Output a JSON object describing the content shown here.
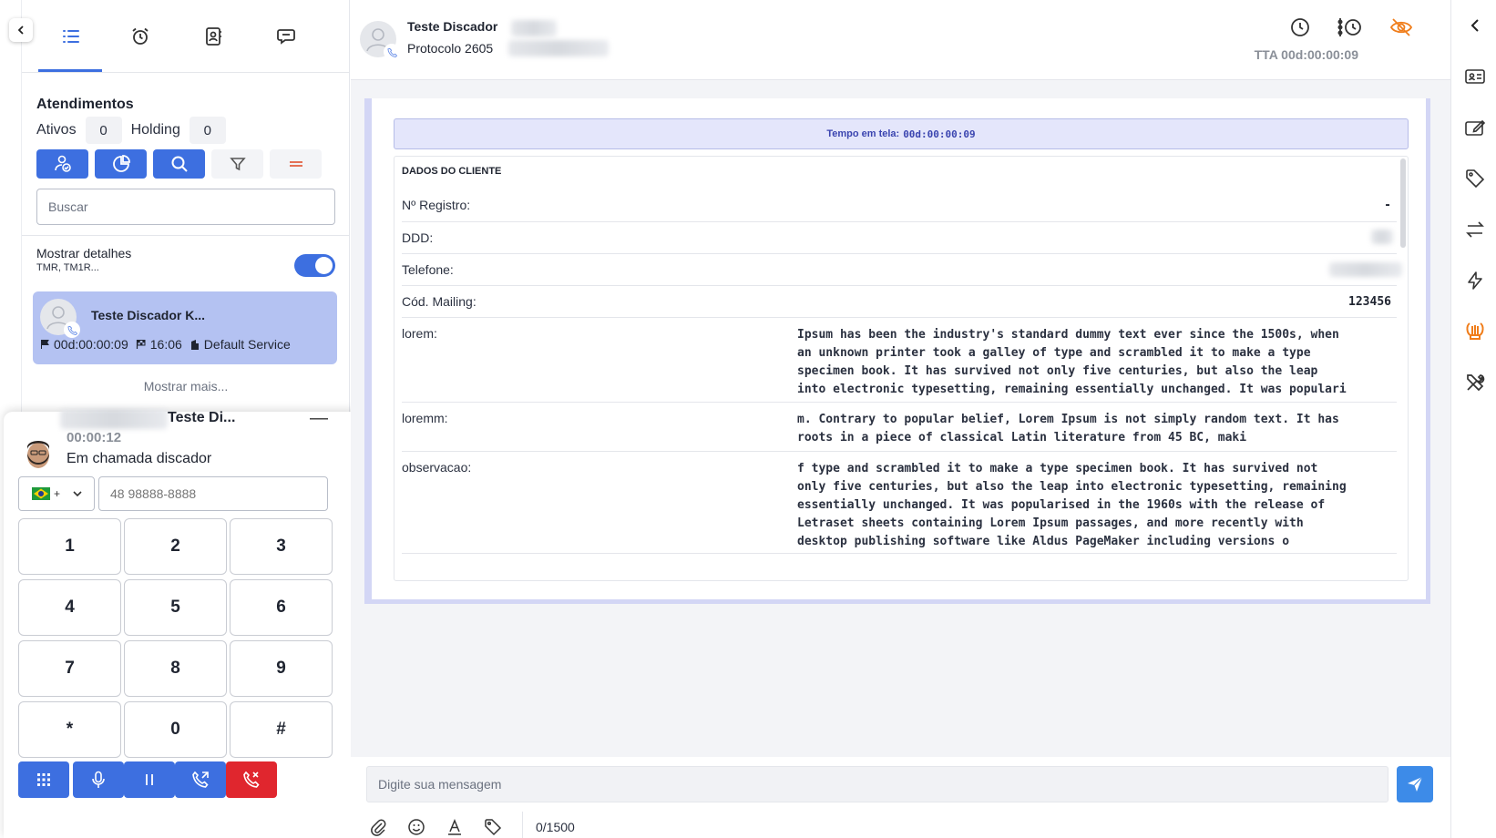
{
  "left_panel": {
    "tabs": [
      {
        "name": "list",
        "icon": "list-icon"
      },
      {
        "name": "alarm",
        "icon": "alarm-clock-icon"
      },
      {
        "name": "contacts",
        "icon": "contact-book-icon"
      },
      {
        "name": "chat",
        "icon": "chat-bubbles-icon"
      }
    ],
    "section_title": "Atendimentos",
    "ativos_label": "Ativos",
    "ativos_count": "0",
    "holding_label": "Holding",
    "holding_count": "0",
    "search_placeholder": "Buscar",
    "details_toggle_label": "Mostrar detalhes",
    "details_toggle_sub": "TMR, TM1R...",
    "details_toggle_on": true,
    "ticket": {
      "name": "Teste Discador K...",
      "duration": "00d:00:00:09",
      "time": "16:06",
      "service": "Default Service"
    },
    "show_more": "Mostrar mais..."
  },
  "softphone": {
    "contact_name": "Teste Di...",
    "call_timer": "00:00:12",
    "status": "Em chamada discador",
    "country_code": "+",
    "phone_placeholder": "48 98888-8888",
    "minimize": "—",
    "keys": [
      "1",
      "2",
      "3",
      "4",
      "5",
      "6",
      "7",
      "8",
      "9",
      "*",
      "0",
      "#"
    ]
  },
  "header": {
    "contact_name": "Teste Discador",
    "protocol_label": "Protocolo 2605",
    "tta": "TTA 00d:00:00:09"
  },
  "form": {
    "timer_label": "Tempo em tela:",
    "timer_value": "00d:00:00:09",
    "section_title": "DADOS DO CLIENTE",
    "fields": [
      {
        "label": "Nº Registro:",
        "value": "-"
      },
      {
        "label": "DDD:",
        "value": ""
      },
      {
        "label": "Telefone:",
        "value": ""
      },
      {
        "label": "Cód. Mailing:",
        "value": "123456"
      },
      {
        "label": "lorem:",
        "value": "Ipsum has been the industry's standard dummy text ever since the 1500s, when\nan unknown printer took a galley of type and scrambled it to make a type\nspecimen book. It has survived not only five centuries, but also the leap\ninto electronic typesetting, remaining essentially unchanged. It was populari"
      },
      {
        "label": "loremm:",
        "value": "m. Contrary to popular belief, Lorem Ipsum is not simply random text. It has\nroots in a piece of classical Latin literature from 45 BC, maki"
      },
      {
        "label": "observacao:",
        "value": "f type and scrambled it to make a type specimen book. It has survived not\nonly five centuries, but also the leap into electronic typesetting, remaining\nessentially unchanged. It was popularised in the 1960s with the release of\nLetraset sheets containing Lorem Ipsum passages, and more recently with\ndesktop publishing software like Aldus PageMaker including versions o"
      }
    ]
  },
  "composer": {
    "placeholder": "Digite sua mensagem",
    "char_count": "0/1500"
  },
  "right_rail": {
    "icons": [
      "chevron-left-icon",
      "id-card-icon",
      "edit-icon",
      "tag-icon",
      "transfer-icon",
      "lightning-icon",
      "lyre-icon",
      "tools-icon"
    ]
  },
  "colors": {
    "primary": "#3d6fe0",
    "danger": "#e0262e",
    "accent_orange": "#f07d1a",
    "card_selected": "#b4c2f2",
    "banner": "#e4e6fb"
  }
}
